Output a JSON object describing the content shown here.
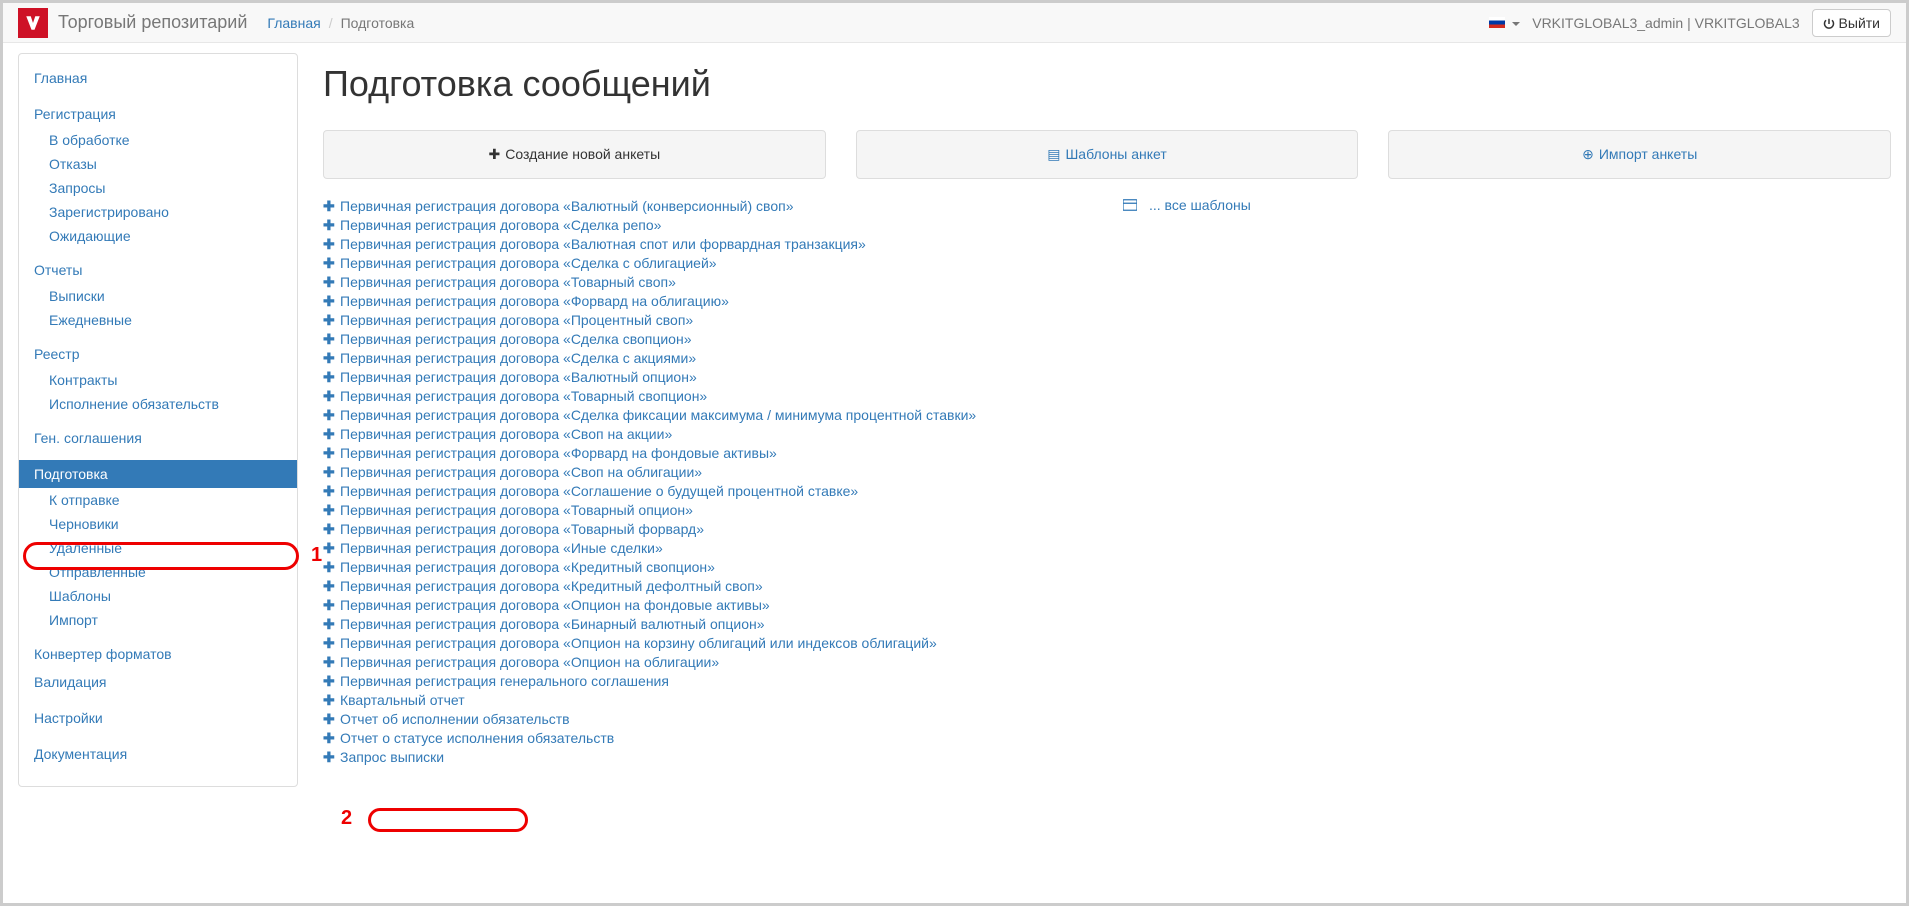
{
  "brand": "Торговый репозитарий",
  "breadcrumb": {
    "home": "Главная",
    "current": "Подготовка"
  },
  "user": "VRKITGLOBAL3_admin | VRKITGLOBAL3",
  "logout": "Выйти",
  "page_title": "Подготовка сообщений",
  "panels": {
    "create": "Создание новой анкеты",
    "templates": "Шаблоны анкет",
    "import": "Импорт анкеты"
  },
  "sidebar": {
    "home": "Главная",
    "reg": {
      "head": "Регистрация",
      "items": [
        "В обработке",
        "Отказы",
        "Запросы",
        "Зарегистрировано",
        "Ожидающие"
      ]
    },
    "reports": {
      "head": "Отчеты",
      "items": [
        "Выписки",
        "Ежедневные"
      ]
    },
    "registry": {
      "head": "Реестр",
      "items": [
        "Контракты",
        "Исполнение обязательств"
      ]
    },
    "gen": "Ген. соглашения",
    "prep": {
      "head": "Подготовка",
      "items": [
        "К отправке",
        "Черновики",
        "Удаленные",
        "Отправленные",
        "Шаблоны",
        "Импорт"
      ]
    },
    "converter": "Конвертер форматов",
    "validation": "Валидация",
    "settings": "Настройки",
    "docs": "Документация"
  },
  "form_links": [
    "Первичная регистрация договора «Валютный (конверсионный) своп»",
    "Первичная регистрация договора «Сделка репо»",
    "Первичная регистрация договора «Валютная спот или форвардная транзакция»",
    "Первичная регистрация договора «Сделка с облигацией»",
    "Первичная регистрация договора «Товарный своп»",
    "Первичная регистрация договора «Форвард на облигацию»",
    "Первичная регистрация договора «Процентный своп»",
    "Первичная регистрация договора «Сделка свопцион»",
    "Первичная регистрация договора «Сделка с акциями»",
    "Первичная регистрация договора «Валютный опцион»",
    "Первичная регистрация договора «Товарный свопцион»",
    "Первичная регистрация договора «Сделка фиксации максимума / минимума процентной ставки»",
    "Первичная регистрация договора «Своп на акции»",
    "Первичная регистрация договора «Форвард на фондовые активы»",
    "Первичная регистрация договора «Своп на облигации»",
    "Первичная регистрация договора «Соглашение о будущей процентной ставке»",
    "Первичная регистрация договора «Товарный опцион»",
    "Первичная регистрация договора «Товарный форвард»",
    "Первичная регистрация договора «Иные сделки»",
    "Первичная регистрация договора «Кредитный свопцион»",
    "Первичная регистрация договора «Кредитный дефолтный своп»",
    "Первичная регистрация договора «Опцион на фондовые активы»",
    "Первичная регистрация договора «Бинарный валютный опцион»",
    "Первичная регистрация договора «Опцион на корзину облигаций или индексов облигаций»",
    "Первичная регистрация договора «Опцион на облигации»",
    "Первичная регистрация генерального соглашения",
    "Квартальный отчет",
    "Отчет об исполнении обязательств",
    "Отчет о статусе исполнения обязательств",
    "Запрос выписки"
  ],
  "all_templates": "... все шаблоны",
  "annotations": {
    "one": "1",
    "two": "2"
  }
}
